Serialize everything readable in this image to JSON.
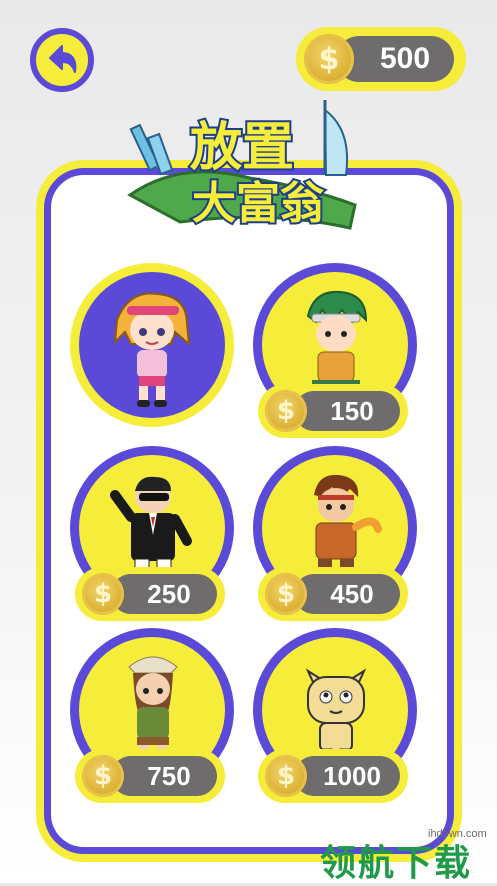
{
  "header": {
    "coins": "500",
    "currency_symbol": "$",
    "back_icon": "back-arrow-icon"
  },
  "logo": {
    "line1": "放置",
    "line2": "大富翁"
  },
  "characters": [
    {
      "id": "girl",
      "selected": true,
      "price": null
    },
    {
      "id": "ninja-boy",
      "selected": false,
      "price": "150"
    },
    {
      "id": "gangster",
      "selected": false,
      "price": "250"
    },
    {
      "id": "warrior",
      "selected": false,
      "price": "450"
    },
    {
      "id": "jungle-girl",
      "selected": false,
      "price": "750"
    },
    {
      "id": "cat",
      "selected": false,
      "price": "1000"
    }
  ],
  "watermark": {
    "url": "ihdown.com",
    "text": "领航下载"
  },
  "colors": {
    "yellow": "#f6ec3a",
    "purple": "#5b49d8",
    "gray_pill": "#6e6c6d",
    "coin_gold": "#d9ad2f"
  }
}
